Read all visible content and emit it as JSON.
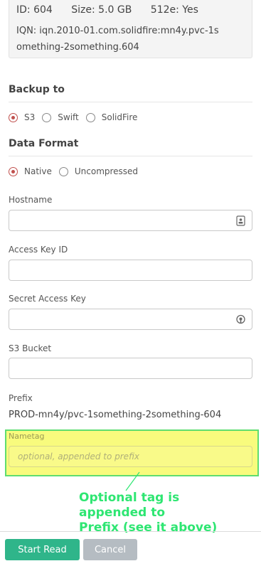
{
  "volume_info": {
    "id": "ID: 604",
    "size": "Size: 5.0 GB",
    "e512": "512e: Yes",
    "iqn_line1": "IQN: iqn.2010-01.com.solidfire:mn4y.pvc-1s",
    "iqn_line2": "omething-2something.604"
  },
  "backup_to": {
    "title": "Backup to",
    "options": [
      {
        "label": "S3",
        "checked": true
      },
      {
        "label": "Swift",
        "checked": false
      },
      {
        "label": "SolidFire",
        "checked": false
      }
    ]
  },
  "data_format": {
    "title": "Data Format",
    "options": [
      {
        "label": "Native",
        "checked": true
      },
      {
        "label": "Uncompressed",
        "checked": false
      }
    ]
  },
  "fields": {
    "hostname": {
      "label": "Hostname",
      "value": "",
      "icon": "contact-card-icon"
    },
    "access_key_id": {
      "label": "Access Key ID",
      "value": ""
    },
    "secret_access_key": {
      "label": "Secret Access Key",
      "value": "",
      "icon": "password-reveal-icon"
    },
    "s3_bucket": {
      "label": "S3 Bucket",
      "value": ""
    }
  },
  "prefix": {
    "label": "Prefix",
    "value": "PROD-mn4y/pvc-1something-2something-604"
  },
  "nametag": {
    "label": "Nametag",
    "placeholder": "optional, appended to prefix",
    "value": ""
  },
  "annotation": {
    "text": "Optional tag is\nappended to\nPrefix (see it above)",
    "color": "#2ee672"
  },
  "buttons": {
    "start": "Start Read",
    "cancel": "Cancel"
  },
  "colors": {
    "primary": "#2fb58a",
    "cancel": "#b5bcc2",
    "radio_checked": "#c0504d",
    "highlight_fill": "#f8fb7d",
    "highlight_border": "#5fdd70"
  }
}
